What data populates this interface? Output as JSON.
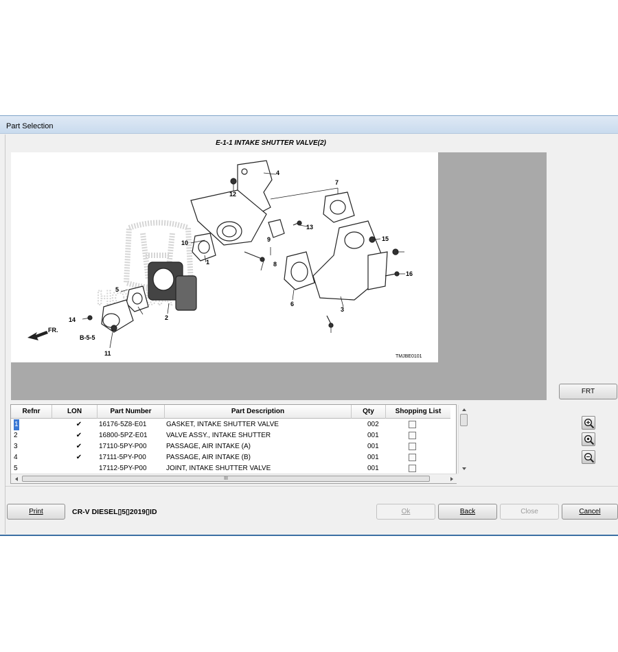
{
  "window": {
    "title": "Part Selection"
  },
  "diagram": {
    "title": "E-1-1 INTAKE SHUTTER VALVE(2)",
    "code": "TMJBE0101",
    "fr_label": "FR.",
    "ref_label": "B-5-5",
    "callouts": [
      "1",
      "2",
      "3",
      "4",
      "5",
      "6",
      "7",
      "8",
      "9",
      "10",
      "11",
      "12",
      "13",
      "14",
      "15",
      "16"
    ],
    "brand_watermark": "HONDA"
  },
  "zoom": {
    "in_icon": "zoom-in-icon",
    "reset_icon": "zoom-reset-icon",
    "out_icon": "zoom-out-icon"
  },
  "frt_button": "FRT",
  "table": {
    "columns": [
      "Refnr",
      "LON",
      "Part Number",
      "Part Description",
      "Qty",
      "Shopping List"
    ],
    "rows": [
      {
        "refnr": "1",
        "lon": "✔",
        "part_number": "16176-5Z8-E01",
        "description": "GASKET, INTAKE SHUTTER VALVE",
        "qty": "002"
      },
      {
        "refnr": "2",
        "lon": "✔",
        "part_number": "16800-5PZ-E01",
        "description": "VALVE ASSY., INTAKE SHUTTER",
        "qty": "001"
      },
      {
        "refnr": "3",
        "lon": "✔",
        "part_number": "17110-5PY-P00",
        "description": "PASSAGE, AIR INTAKE (A)",
        "qty": "001"
      },
      {
        "refnr": "4",
        "lon": "✔",
        "part_number": "17111-5PY-P00",
        "description": "PASSAGE, AIR INTAKE (B)",
        "qty": "001"
      },
      {
        "refnr": "5",
        "lon": "",
        "part_number": "17112-5PY-P00",
        "description": "JOINT, INTAKE SHUTTER VALVE",
        "qty": "001"
      }
    ],
    "hscroll_thumb_label": "III"
  },
  "footer": {
    "print": "Print",
    "vehicle": "CR-V DIESEL▯5▯2019▯ID",
    "ok": "Ok",
    "back": "Back",
    "close": "Close",
    "cancel": "Cancel"
  }
}
